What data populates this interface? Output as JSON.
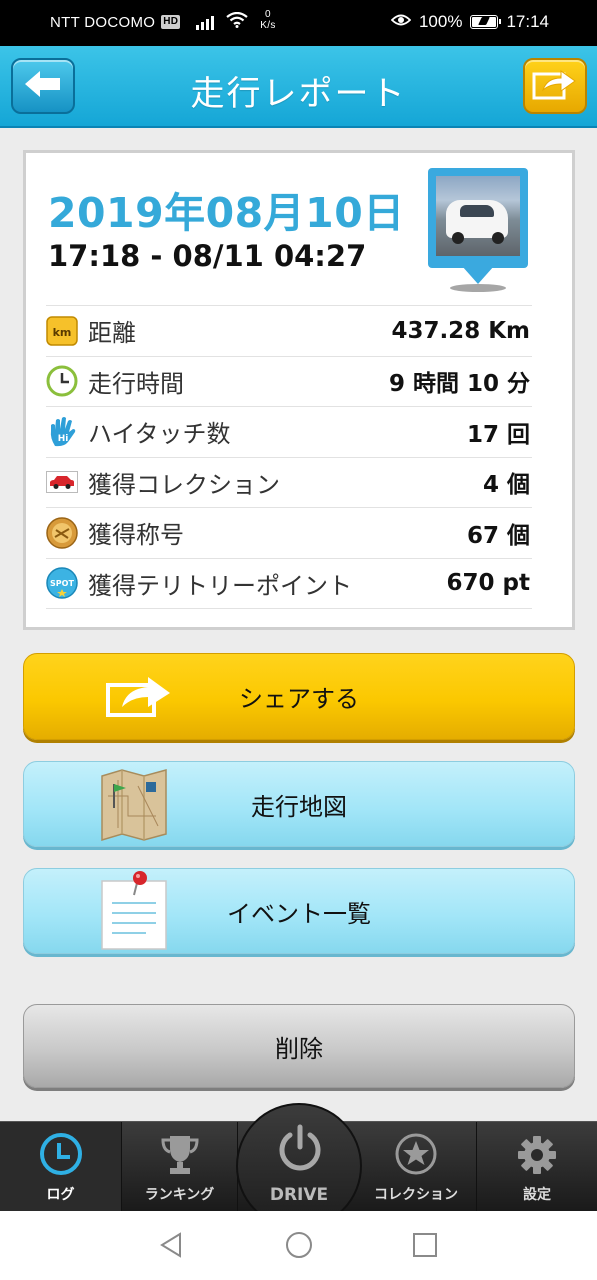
{
  "status_bar": {
    "carrier": "NTT DOCOMO",
    "hd_badge": "HD",
    "net_speed_value": "0",
    "net_speed_unit": "K/s",
    "battery": "100%",
    "time": "17:14"
  },
  "header": {
    "title": "走行レポート"
  },
  "report": {
    "date": "2019年08月10日",
    "time_range": "17:18 - 08/11 04:27",
    "stats": [
      {
        "icon": "km-badge-icon",
        "icon_text": "km",
        "label": "距離",
        "value": "437.28 Km"
      },
      {
        "icon": "clock-icon",
        "label": "走行時間",
        "value": "9 時間 10 分"
      },
      {
        "icon": "high-five-hand-icon",
        "label": "ハイタッチ数",
        "value": "17 回"
      },
      {
        "icon": "car-icon",
        "label": "獲得コレクション",
        "value": "4 個"
      },
      {
        "icon": "title-medal-icon",
        "label": "獲得称号",
        "value": "67 個"
      },
      {
        "icon": "spot-badge-icon",
        "icon_text": "SPOT",
        "label": "獲得テリトリーポイント",
        "value": "670 pt"
      }
    ]
  },
  "buttons": {
    "share": "シェアする",
    "map": "走行地図",
    "events": "イベント一覧",
    "delete": "削除"
  },
  "tabbar": {
    "items": [
      {
        "label": "ログ",
        "icon": "log-clock-icon",
        "active": true
      },
      {
        "label": "ランキング",
        "icon": "trophy-icon",
        "active": false
      },
      {
        "label": "DRIVE",
        "icon": "power-icon",
        "active": false
      },
      {
        "label": "コレクション",
        "icon": "star-icon",
        "active": false
      },
      {
        "label": "設定",
        "icon": "gear-icon",
        "active": false
      }
    ]
  },
  "colors": {
    "header_blue": "#15a6d6",
    "date_blue": "#35a9d9",
    "share_yellow": "#fbc800",
    "map_button_blue": "#a3e6f8",
    "delete_gray": "#c9c9c9"
  }
}
